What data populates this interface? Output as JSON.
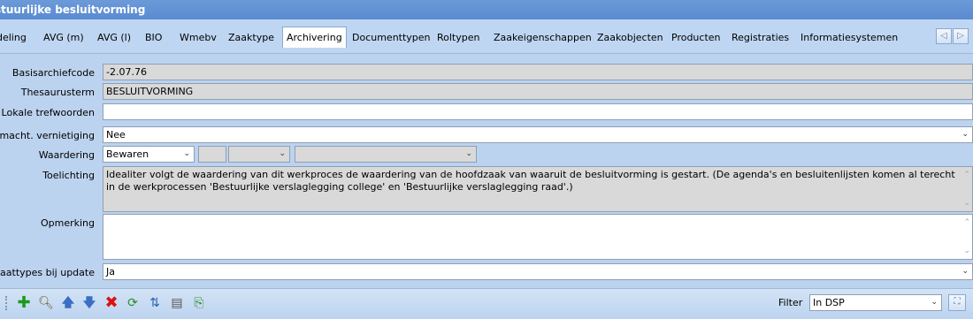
{
  "window": {
    "title": "stuurlijke besluitvorming"
  },
  "tabs": [
    {
      "label": "deling"
    },
    {
      "label": "AVG (m)"
    },
    {
      "label": "AVG (l)"
    },
    {
      "label": "BIO"
    },
    {
      "label": "Wmebv"
    },
    {
      "label": "Zaaktype"
    },
    {
      "label": "Archivering"
    },
    {
      "label": "Documenttypen"
    },
    {
      "label": "Roltypen"
    },
    {
      "label": "Zaakeigenschappen"
    },
    {
      "label": "Zaakobjecten"
    },
    {
      "label": "Producten"
    },
    {
      "label": "Registraties"
    },
    {
      "label": "Informatiesystemen"
    }
  ],
  "active_tab": "Archivering",
  "form": {
    "basisarchiefcode": {
      "label": "Basisarchiefcode",
      "value": "-2.07.76"
    },
    "thesaurusterm": {
      "label": "Thesaurusterm",
      "value": "BESLUITVORMING"
    },
    "lokale_trefwoorden": {
      "label": "Lokale trefwoorden",
      "value": ""
    },
    "vernietiging": {
      "label": "l. macht.  vernietiging",
      "value": "Nee"
    },
    "waardering": {
      "label": "Waardering",
      "value": "Bewaren",
      "field2": "",
      "field3": "",
      "field4": ""
    },
    "toelichting": {
      "label": "Toelichting",
      "value": "Idealiter volgt de waardering van dit werkproces de waardering van de hoofdzaak van waaruit de besluitvorming is gestart. (De agenda's en besluitenlijsten komen al terecht in de werkprocessen 'Bestuurlijke verslaglegging college' en 'Bestuurlijke verslaglegging raad'.)"
    },
    "opmerking": {
      "label": "Opmerking",
      "value": ""
    },
    "resultaattypes": {
      "label": "ultaattypes bij update",
      "value": "Ja"
    }
  },
  "toolbar": {
    "filter_label": "Filter",
    "filter_value": "In DSP",
    "icons": [
      "add-icon",
      "search-icon",
      "move-up-icon",
      "move-down-icon",
      "delete-icon",
      "refresh-icon",
      "sort-icon",
      "archive-icon",
      "export-icon"
    ]
  }
}
